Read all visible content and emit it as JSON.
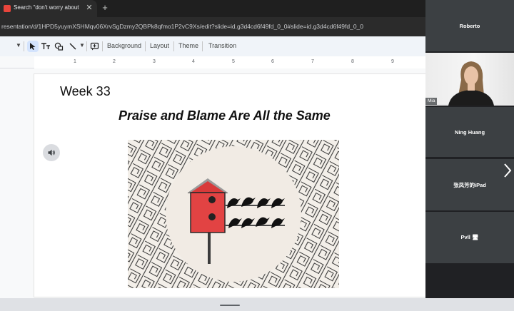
{
  "browser": {
    "tab_title": "Search \"don't worry about\" in ",
    "tab_close": "✕",
    "new_tab": "+",
    "url": "resentation/d/1HPD5yuymXSHMqv06XrvSgDzmy2QBPk8qfmo1P2vC9Xs/edit?slide=id.g3d4cd6f49fd_0_0#slide=id.g3d4cd6f49fd_0_0"
  },
  "toolbar": {
    "background_label": "Background",
    "layout_label": "Layout",
    "theme_label": "Theme",
    "transition_label": "Transition"
  },
  "ruler": {
    "ticks": [
      "1",
      "2",
      "3",
      "4",
      "5",
      "6",
      "7",
      "8",
      "9"
    ]
  },
  "slide": {
    "week": "Week 33",
    "title": "Praise and Blame Are All the Same"
  },
  "participants": [
    {
      "name": "Roberto"
    },
    {
      "name": "Mia",
      "has_video": true
    },
    {
      "name": "Ning Huang"
    },
    {
      "name": "张凤芳的iPad"
    },
    {
      "name": "Pvll 🖥"
    }
  ],
  "colors": {
    "accent": "#d3e3fd",
    "birdhouse": "#e03c3c",
    "panel_tile": "#3c4043"
  }
}
